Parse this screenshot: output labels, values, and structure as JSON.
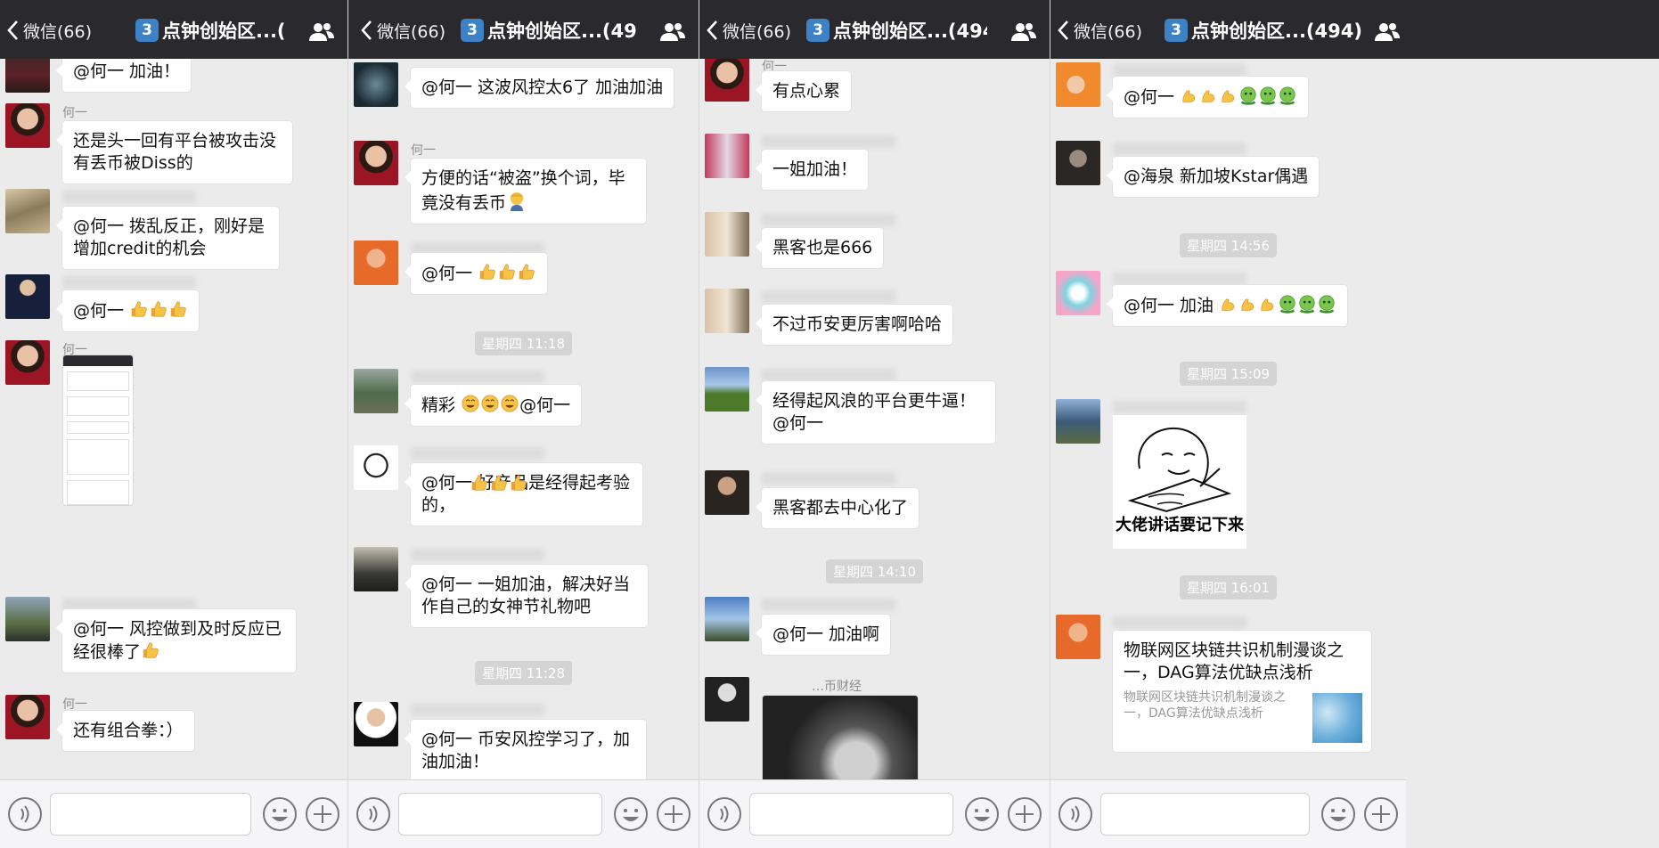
{
  "nav": {
    "back_label": "微信(66)",
    "badge": "3",
    "group_title": "点钟创始区...(494)"
  },
  "panels": [
    {
      "messages": [
        {
          "name": "",
          "text": "@何一 加油！"
        },
        {
          "name": "何一",
          "text": "还是头一回有平台被攻击没有丢币被Diss的"
        },
        {
          "name": "",
          "text": "@何一 拨乱反正，刚好是增加credit的机会"
        },
        {
          "name": "",
          "text": "@何一"
        },
        {
          "name": "何一",
          "text": ""
        },
        {
          "name": "",
          "text": "@何一 风控做到及时反应已经很棒了"
        },
        {
          "name": "何一",
          "text": "还有组合拳：）"
        }
      ]
    },
    {
      "messages": [
        {
          "name": "",
          "text": "@何一 这波风控太6了 加油加油"
        },
        {
          "name": "何一",
          "text": "方便的话“被盗”换个词，毕竟没有丢币"
        },
        {
          "name": "",
          "text": "@何一"
        },
        {
          "name": "",
          "text": "精彩"
        },
        {
          "name": "",
          "text": "@何一 好产品是经得起考验的，"
        },
        {
          "name": "",
          "text": "@何一 一姐加油，解决好当作自己的女神节礼物吧"
        },
        {
          "name": "",
          "text": "@何一 币安风控学习了，加油加油！"
        }
      ],
      "times": [
        "星期四 11:18",
        "星期四 11:28"
      ]
    },
    {
      "messages": [
        {
          "name": "何一",
          "text": "有点心累"
        },
        {
          "name": "",
          "text": "一姐加油！"
        },
        {
          "name": "",
          "text": "黑客也是666"
        },
        {
          "name": "",
          "text": "不过币安更厉害啊哈哈"
        },
        {
          "name": "",
          "text": "经得起风浪的平台更牛逼！@何一"
        },
        {
          "name": "",
          "text": "黑客都去中心化了"
        },
        {
          "name": "",
          "text": "@何一 加油啊"
        },
        {
          "name": "…币财经",
          "text": ""
        }
      ],
      "times": [
        "星期四 14:10"
      ]
    },
    {
      "messages": [
        {
          "name": "",
          "text": "@何一"
        },
        {
          "name": "",
          "text": "@海泉 新加坡Kstar偶遇"
        },
        {
          "name": "",
          "text": "@何一 加油"
        },
        {
          "name": "",
          "text": ""
        },
        {
          "name": "",
          "link_title": "物联网区块链共识机制漫谈之一，DAG算法优缺点浅析",
          "link_desc": "物联网区块链共识机制漫谈之一，DAG算法优缺点浅析"
        }
      ],
      "times": [
        "星期四 14:56",
        "星期四 15:09",
        "星期四 16:01"
      ],
      "sticker_text": "大佬讲话要记下来"
    }
  ],
  "icons": {
    "back": "chevron-left-icon",
    "mute": "mute-bell-icon",
    "members": "group-members-icon",
    "voice": "voice-icon",
    "emoji": "emoji-icon",
    "plus": "plus-icon",
    "thumbs": "thumbs-up-emoji",
    "muscle": "flexed-biceps-emoji"
  },
  "colors": {
    "navbar": "#2a2a2e",
    "chat_bg": "#ebebeb",
    "bubble": "#ffffff",
    "badge": "#3d82c6"
  }
}
